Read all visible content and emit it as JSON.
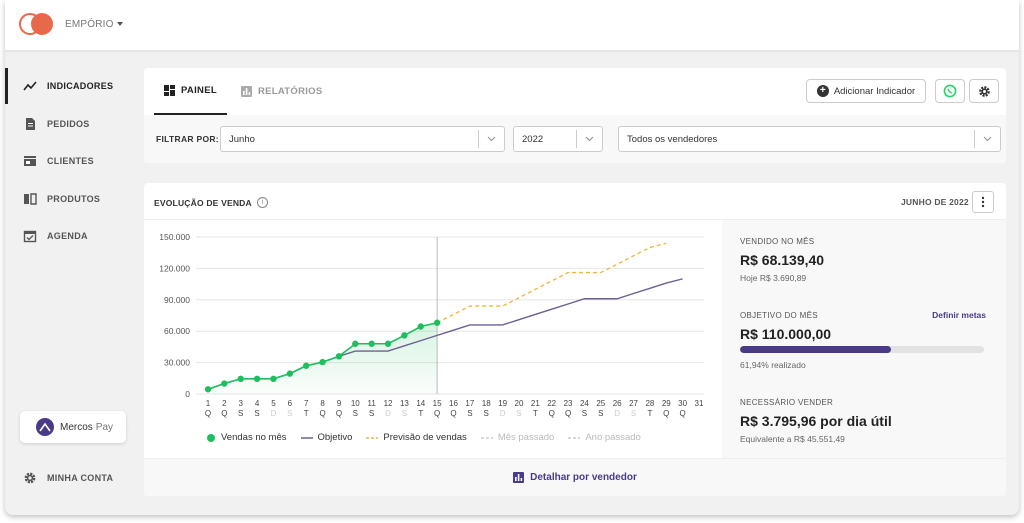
{
  "header": {
    "company": "EMPÓRIO"
  },
  "sidebar": {
    "items": [
      {
        "label": "INDICADORES",
        "icon": "trending-up-icon",
        "active": true
      },
      {
        "label": "PEDIDOS",
        "icon": "document-icon"
      },
      {
        "label": "CLIENTES",
        "icon": "store-icon"
      },
      {
        "label": "PRODUTOS",
        "icon": "book-icon"
      },
      {
        "label": "AGENDA",
        "icon": "calendar-check-icon"
      }
    ],
    "mercos_pay": {
      "brand": "Mercos",
      "suffix": "Pay"
    },
    "account": "MINHA CONTA"
  },
  "tabs": [
    {
      "label": "PAINEL",
      "active": true
    },
    {
      "label": "RELATÓRIOS"
    }
  ],
  "toolbar": {
    "add_indicator": "Adicionar Indicador"
  },
  "filters": {
    "label": "FILTRAR POR:",
    "month": "Junho",
    "year": "2022",
    "seller": "Todos os vendedores"
  },
  "sales_panel": {
    "title": "EVOLUÇÃO DE VENDA",
    "period": "JUNHO DE 2022",
    "footer_link": "Detalhar por vendedor"
  },
  "stats": {
    "sold_label": "VENDIDO NO MÊS",
    "sold_value": "R$ 68.139,40",
    "sold_today": "Hoje R$ 3.690,89",
    "goal_label": "OBJETIVO DO MÊS",
    "goal_link": "Definir metas",
    "goal_value": "R$ 110.000,00",
    "goal_progress": 0.6194,
    "goal_progress_text": "61,94% realizado",
    "needed_label": "NECESSÁRIO VENDER",
    "needed_value": "R$ 3.795,96 por dia útil",
    "needed_sub": "Equivalente a R$ 45.551,49"
  },
  "colors": {
    "accent": "#4a3a87",
    "brand": "#e8684a",
    "sales": "#1fbf5f",
    "forecast": "#f0b43c"
  },
  "chart_data": {
    "type": "line",
    "x": [
      "1",
      "2",
      "3",
      "4",
      "5",
      "6",
      "7",
      "8",
      "9",
      "10",
      "11",
      "12",
      "13",
      "14",
      "15",
      "16",
      "17",
      "18",
      "19",
      "20",
      "21",
      "22",
      "23",
      "24",
      "25",
      "26",
      "27",
      "28",
      "29",
      "30",
      "31"
    ],
    "weekdays": [
      "Q",
      "Q",
      "S",
      "S",
      "D",
      "S",
      "T",
      "Q",
      "Q",
      "S",
      "S",
      "D",
      "S",
      "T",
      "Q",
      "Q",
      "S",
      "S",
      "D",
      "S",
      "T",
      "Q",
      "Q",
      "S",
      "S",
      "D",
      "S",
      "T",
      "Q",
      "Q",
      ""
    ],
    "weekend_days": [
      4,
      5,
      11,
      12,
      18,
      19,
      25,
      26
    ],
    "today_index": 14,
    "ylim": [
      0,
      150000
    ],
    "yticks": [
      0,
      30000,
      60000,
      90000,
      120000,
      150000
    ],
    "ytick_labels": [
      "0",
      "30.000",
      "60.000",
      "90.000",
      "120.000",
      "150.000"
    ],
    "series": [
      {
        "name": "Vendas no mês",
        "color": "#1fbf5f",
        "style": "solid-dots",
        "values": [
          4500,
          10000,
          14500,
          14500,
          14500,
          19500,
          27000,
          30500,
          36000,
          48000,
          48000,
          48000,
          56000,
          64500,
          68100
        ]
      },
      {
        "name": "Objetivo",
        "color": "#6e5f93",
        "style": "solid",
        "values": [
          4500,
          10000,
          14500,
          14500,
          14500,
          19500,
          27000,
          30500,
          36000,
          41000,
          41000,
          41000,
          46000,
          51000,
          56000,
          61000,
          66000,
          66000,
          66000,
          71000,
          76000,
          81000,
          86000,
          91000,
          91000,
          91000,
          96000,
          101000,
          106000,
          110000
        ]
      },
      {
        "name": "Previsão de vendas",
        "color": "#f0b43c",
        "style": "dashed",
        "start_index": 14,
        "values": [
          68100,
          76000,
          84000,
          84000,
          84000,
          92000,
          100000,
          108000,
          116000,
          116000,
          116000,
          124000,
          132000,
          140000,
          144000
        ]
      },
      {
        "name": "Mês passado",
        "color": "#cccccc",
        "style": "dashed",
        "values": []
      },
      {
        "name": "Ano passado",
        "color": "#cccccc",
        "style": "dashed",
        "values": []
      }
    ]
  }
}
